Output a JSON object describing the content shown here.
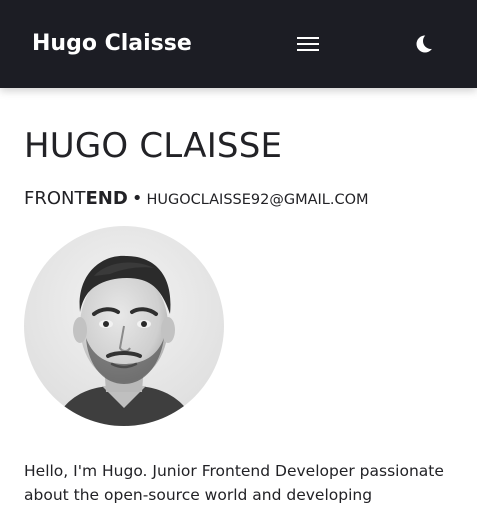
{
  "header": {
    "brand": "Hugo Claisse",
    "menu_icon": "hamburger-menu-icon",
    "theme_icon": "moon-icon",
    "background": "#1c1d24"
  },
  "profile": {
    "name": "HUGO CLAISSE",
    "role_start": "FRONT",
    "role_end": "END",
    "separator": "•",
    "email": "HUGOCLAISSE92@GMAIL.COM",
    "avatar_icon": "profile-photo"
  },
  "bio": {
    "text": "Hello, I'm Hugo. Junior Frontend Developer passionate about the open-source world and developing"
  }
}
